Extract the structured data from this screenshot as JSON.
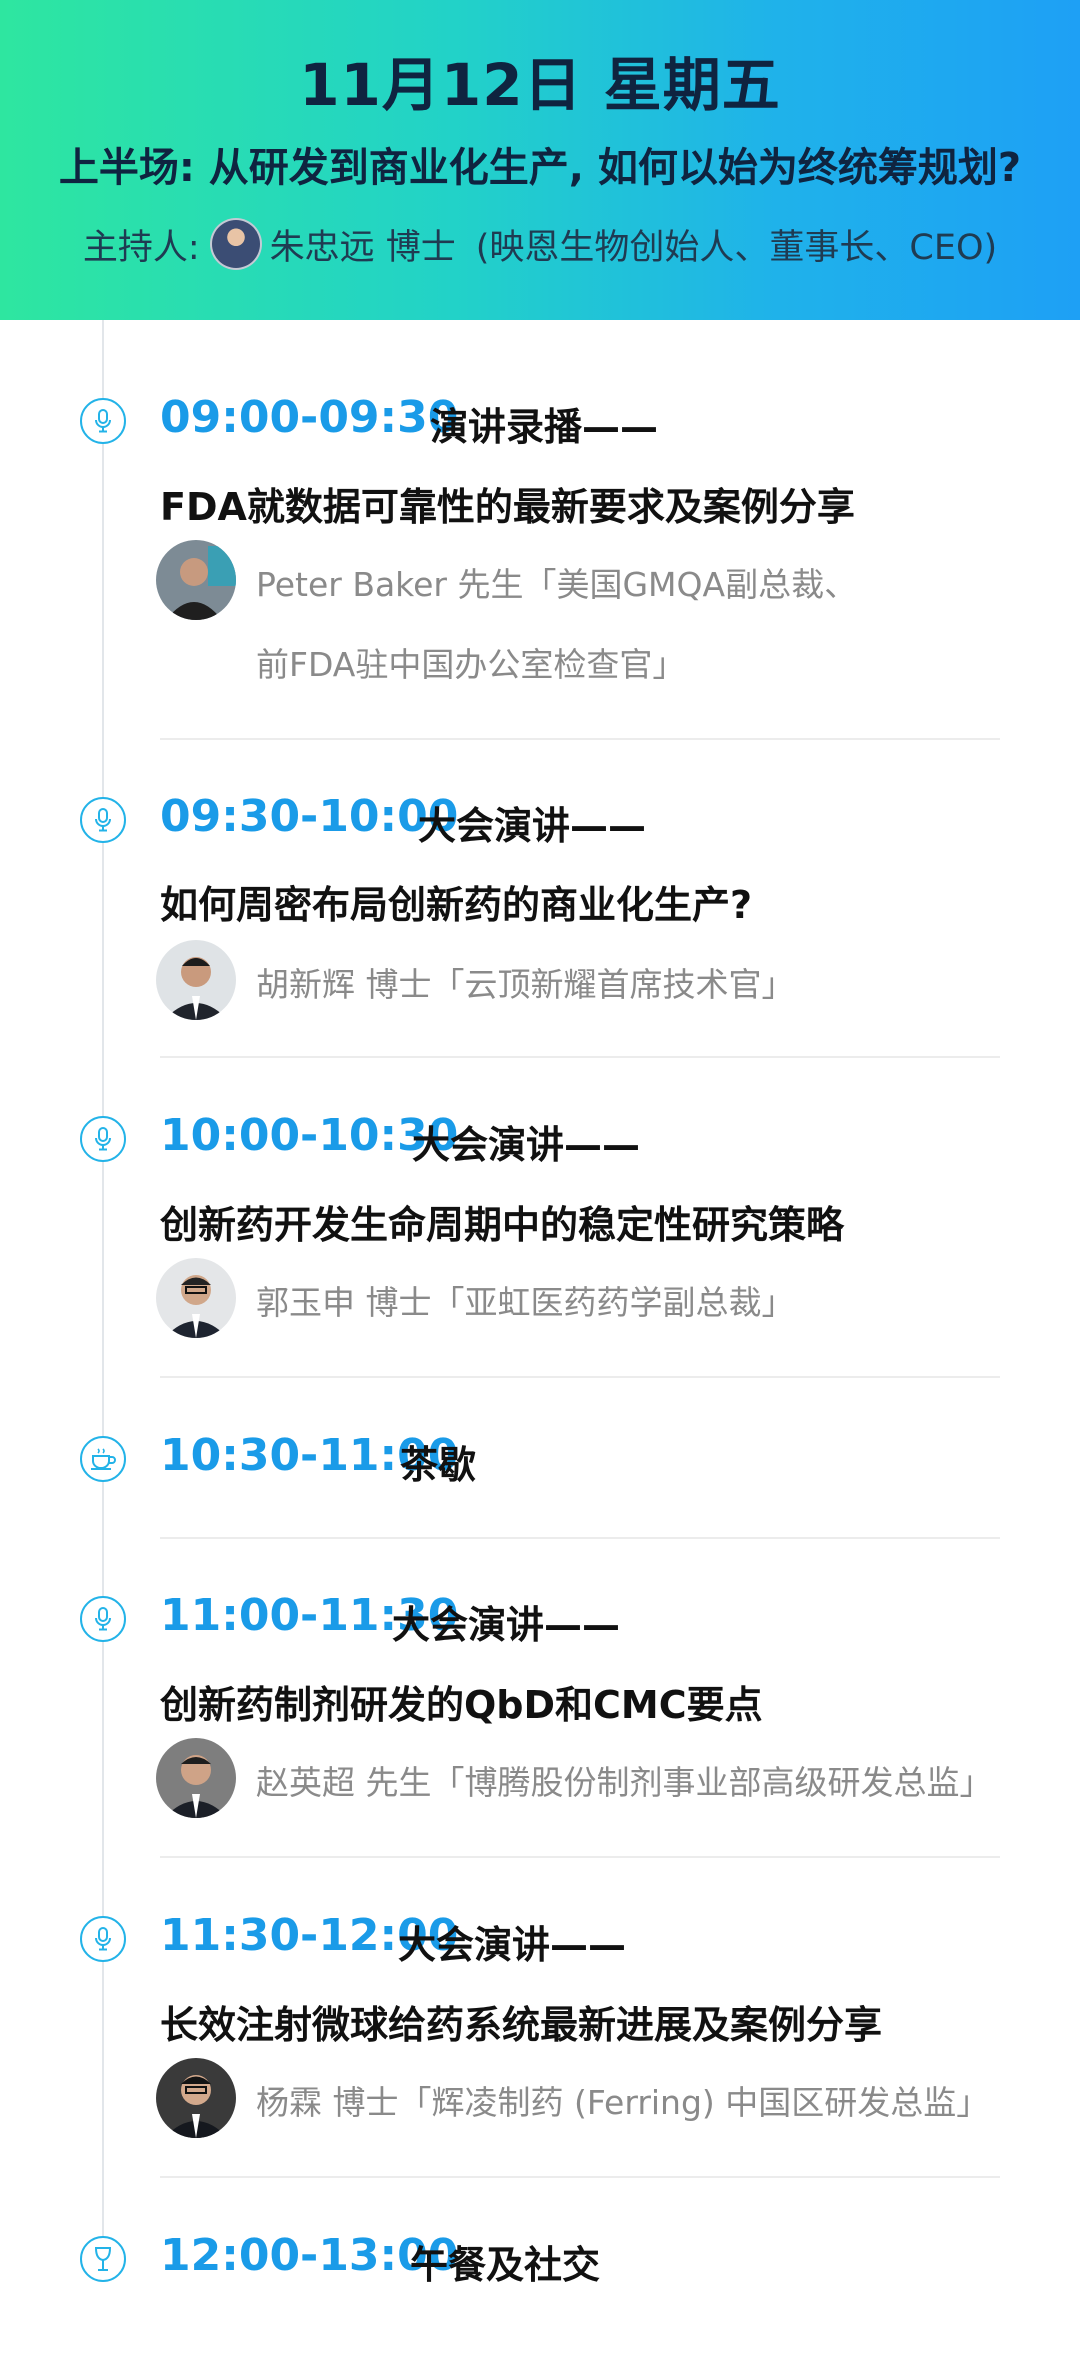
{
  "header": {
    "date": "11月12日 星期五",
    "subtitle": "上半场: 从研发到商业化生产, 如何以始为终统筹规划?",
    "host_label": "主持人:",
    "host_name": "朱忠远 博士",
    "host_title": "(映恩生物创始人、董事长、CEO)"
  },
  "sessions": [
    {
      "time": "09:00-09:30",
      "type": "演讲录播——",
      "title": "FDA就数据可靠性的最新要求及案例分享",
      "speaker_line1": "Peter Baker 先生「美国GMQA副总裁、",
      "speaker_line2": "前FDA驻中国办公室检查官」",
      "icon": "microphone-icon"
    },
    {
      "time": "09:30-10:00",
      "type": "大会演讲——",
      "title": "如何周密布局创新药的商业化生产?",
      "speaker_line1": "胡新辉 博士「云顶新耀首席技术官」",
      "icon": "microphone-icon"
    },
    {
      "time": "10:00-10:30",
      "type": "大会演讲——",
      "title": "创新药开发生命周期中的稳定性研究策略",
      "speaker_line1": "郭玉申 博士「亚虹医药药学副总裁」",
      "icon": "microphone-icon"
    },
    {
      "time": "10:30-11:00",
      "type": "茶歇",
      "icon": "tea-cup-icon"
    },
    {
      "time": "11:00-11:30",
      "type": "大会演讲——",
      "title": "创新药制剂研发的QbD和CMC要点",
      "speaker_line1": "赵英超 先生「博腾股份制剂事业部高级研发总监」",
      "icon": "microphone-icon"
    },
    {
      "time": "11:30-12:00",
      "type": "大会演讲——",
      "title": "长效注射微球给药系统最新进展及案例分享",
      "speaker_line1": "杨霖 博士「辉凌制药 (Ferring) 中国区研发总监」",
      "icon": "microphone-icon"
    },
    {
      "time": "12:00-13:00",
      "type": "午餐及社交",
      "icon": "wine-glass-icon"
    }
  ],
  "colors": {
    "accent_blue": "#1a9be8",
    "header_gradient_start": "#2ee6a0",
    "header_gradient_end": "#1ea0f5",
    "speaker_text": "#8a8a8a"
  }
}
